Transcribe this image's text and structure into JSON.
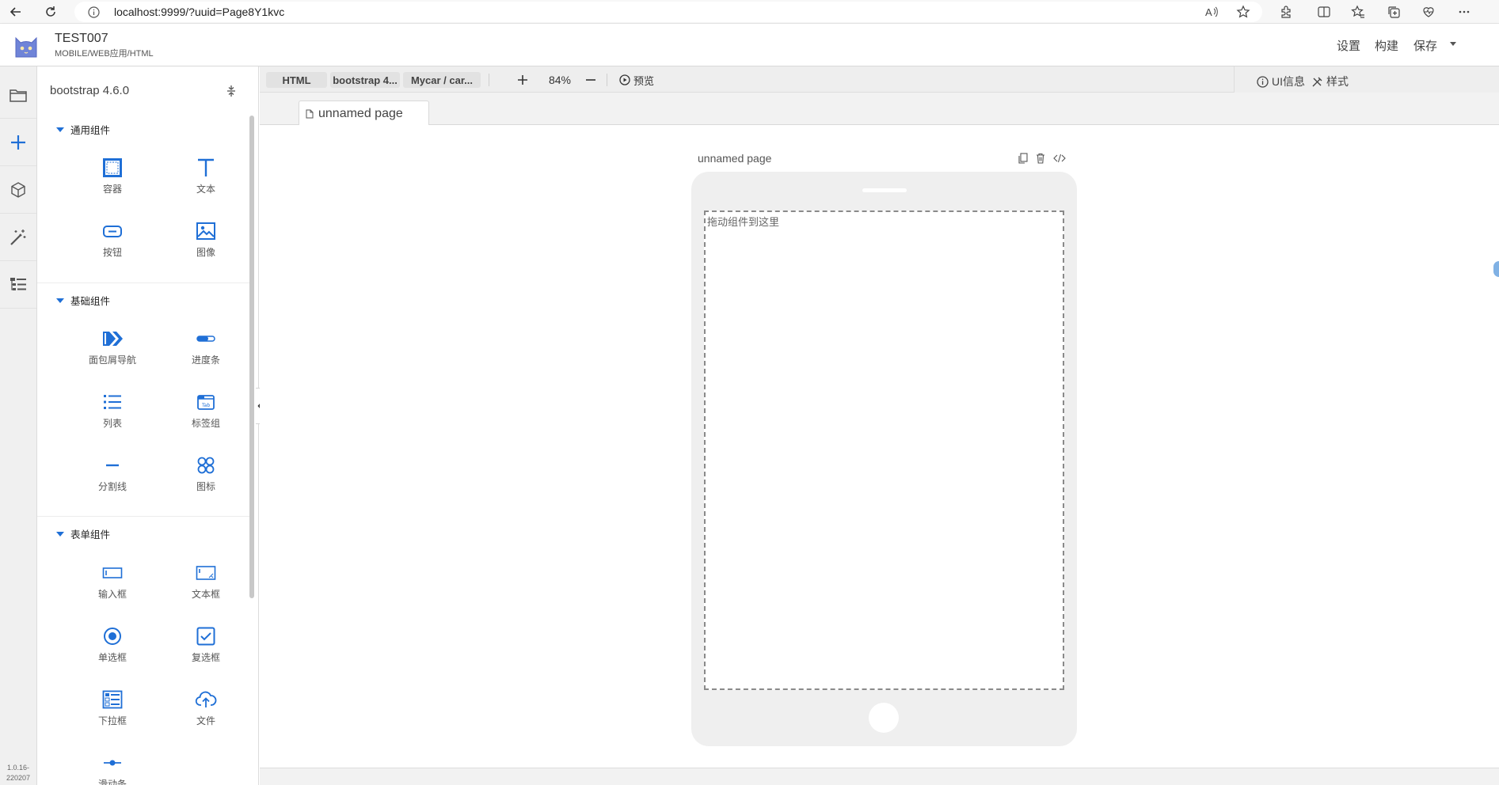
{
  "browser": {
    "url": "localhost:9999/?uuid=Page8Y1kvc",
    "icons": [
      "back-icon",
      "reload-icon",
      "info-icon",
      "read-aloud-icon",
      "favorite-star-icon",
      "extensions-icon",
      "split-screen-icon",
      "favorites-icon",
      "collections-icon",
      "performance-icon",
      "more-icon"
    ]
  },
  "header": {
    "project_name": "TEST007",
    "project_type": "MOBILE/WEB应用/HTML",
    "actions": [
      "设置",
      "构建",
      "保存"
    ]
  },
  "rail": {
    "items": [
      "pages-icon",
      "add-component-icon",
      "cube-icon",
      "magic-wand-icon",
      "outline-tree-icon"
    ],
    "version_line1": "1.0.16-",
    "version_line2": "220207"
  },
  "panel": {
    "title": "bootstrap 4.6.0",
    "sections": [
      {
        "title": "通用组件",
        "items": [
          {
            "label": "容器",
            "icon": "container-icon"
          },
          {
            "label": "文本",
            "icon": "text-icon"
          },
          {
            "label": "按钮",
            "icon": "button-icon"
          },
          {
            "label": "图像",
            "icon": "image-icon"
          }
        ]
      },
      {
        "title": "基础组件",
        "items": [
          {
            "label": "面包屑导航",
            "icon": "breadcrumb-icon"
          },
          {
            "label": "进度条",
            "icon": "progress-icon"
          },
          {
            "label": "列表",
            "icon": "list-icon"
          },
          {
            "label": "标签组",
            "icon": "tabs-icon"
          },
          {
            "label": "分割线",
            "icon": "divider-icon"
          },
          {
            "label": "图标",
            "icon": "icon-grid-icon"
          }
        ]
      },
      {
        "title": "表单组件",
        "items": [
          {
            "label": "输入框",
            "icon": "input-icon"
          },
          {
            "label": "文本框",
            "icon": "textarea-icon"
          },
          {
            "label": "单选框",
            "icon": "radio-icon"
          },
          {
            "label": "复选框",
            "icon": "checkbox-icon"
          },
          {
            "label": "下拉框",
            "icon": "select-icon"
          },
          {
            "label": "文件",
            "icon": "upload-icon"
          },
          {
            "label": "滑动条",
            "icon": "slider-icon"
          }
        ]
      }
    ]
  },
  "toolbar": {
    "breadcrumbs": [
      "HTML",
      "bootstrap 4...",
      "Mycar / car..."
    ],
    "zoom": "84%",
    "preview_label": "预览",
    "ui_info_label": "UI信息",
    "style_label": "样式"
  },
  "tabs": {
    "active": "unnamed page"
  },
  "canvas": {
    "page_label": "unnamed page",
    "drop_hint": "拖动组件到这里",
    "page_actions": [
      "copy-icon",
      "delete-icon",
      "code-icon"
    ]
  },
  "colors": {
    "accent": "#1f6fd6",
    "rail_bg": "#f0f0f0",
    "toolbar_bg": "#eeeeee",
    "phone_bg": "#efefef"
  }
}
